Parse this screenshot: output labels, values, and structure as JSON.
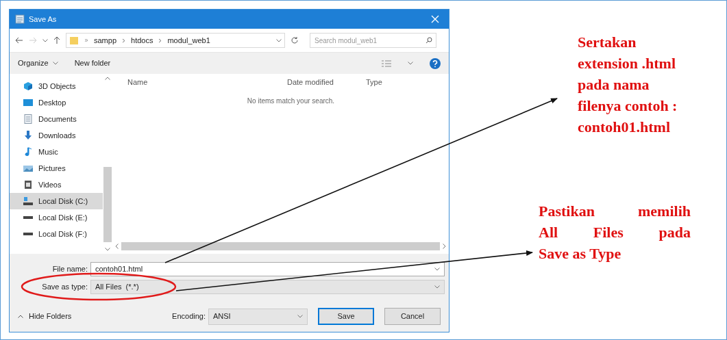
{
  "window": {
    "title": "Save As"
  },
  "address": {
    "path": [
      "sampp",
      "htdocs",
      "modul_web1"
    ],
    "search_placeholder": "Search modul_web1"
  },
  "toolbar": {
    "organize": "Organize",
    "new_folder": "New folder"
  },
  "sidebar": {
    "items": [
      {
        "label": "3D Objects",
        "selected": false
      },
      {
        "label": "Desktop",
        "selected": false
      },
      {
        "label": "Documents",
        "selected": false
      },
      {
        "label": "Downloads",
        "selected": false
      },
      {
        "label": "Music",
        "selected": false
      },
      {
        "label": "Pictures",
        "selected": false
      },
      {
        "label": "Videos",
        "selected": false
      },
      {
        "label": "Local Disk (C:)",
        "selected": true
      },
      {
        "label": "Local Disk (E:)",
        "selected": false
      },
      {
        "label": "Local Disk (F:)",
        "selected": false
      }
    ]
  },
  "table": {
    "columns": [
      "Name",
      "Date modified",
      "Type"
    ],
    "empty_message": "No items match your search."
  },
  "form": {
    "file_name_label": "File name:",
    "file_name": "contoh01.html",
    "type_label": "Save as type:",
    "type": "All Files  (*.*)"
  },
  "footer": {
    "hide_folders": "Hide Folders",
    "encoding_label": "Encoding:",
    "encoding": "ANSI",
    "buttons": [
      "Save",
      "Cancel"
    ]
  },
  "annotations": [
    {
      "lines": [
        "Sertakan",
        "extension .html",
        "pada nama",
        "filenya contoh :",
        "contoh01.html"
      ],
      "justify": false
    },
    {
      "lines": [
        "Pastikan memilih",
        "All Files pada",
        "Save as Type"
      ],
      "justify": true
    }
  ]
}
